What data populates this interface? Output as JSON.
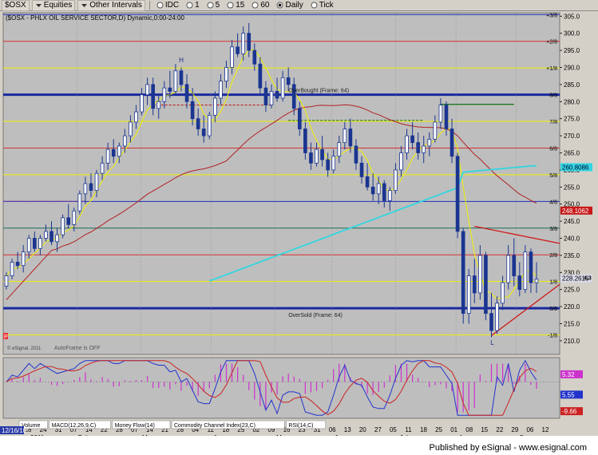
{
  "toolbar": {
    "symbol": "$OSX",
    "equities": "Equities",
    "other_intervals": "Other Intervals",
    "intervals": [
      "IDC",
      "1",
      "5",
      "15",
      "60",
      "Daily",
      "Tick"
    ],
    "active_interval": "Daily"
  },
  "chart_title": "($OSX - PHLX OIL SERVICE SECTOR,D) Dynamic,0:00-24:00",
  "watermark": "© eSignal, 2011",
  "autoframe_note": "AutoFrame is OFF",
  "left_tag": "P",
  "date_badge": "12/16/10",
  "year_label": "2011",
  "credit": "Published by eSignal - www.esignal.com",
  "panes_tabs": [
    "Volume",
    "MACD(12,26,9,C)",
    "Money Flow(14)",
    "Commodity Channel Index(23,C)",
    "RSI(14,C)"
  ],
  "colors": {
    "chart_bg": "#bebebe",
    "candle": "#1a3590",
    "ma_red": "#b22222",
    "ma_yellow": "#f0f000",
    "ma_cyan": "#33d6e0",
    "red_line": "#d63030",
    "yellow_line": "#f0f000",
    "blue_line": "#1f2fb8",
    "thick_blue": "#1a2aa0",
    "green_line": "#1d7a1d"
  },
  "chart_data": {
    "type": "candlestick",
    "symbol": "$OSX",
    "name": "PHLX OIL SERVICE SECTOR",
    "interval": "Daily",
    "y_range": [
      206,
      306
    ],
    "y_ticks": [
      210,
      215,
      220,
      225,
      230,
      235,
      240,
      245,
      250,
      255,
      260,
      265,
      270,
      275,
      280,
      285,
      290,
      295,
      300,
      305
    ],
    "x_ticks": [
      "10",
      "18",
      "24",
      "31",
      "07",
      "14",
      "22",
      "28",
      "07",
      "14",
      "21",
      "28",
      "04",
      "11",
      "18",
      "25",
      "02",
      "09",
      "16",
      "23",
      "31",
      "06",
      "13",
      "20",
      "27",
      "05",
      "11",
      "18",
      "25",
      "01",
      "08",
      "15",
      "22",
      "29",
      "06",
      "12"
    ],
    "month_labels": [
      "Feb",
      "Mar",
      "Apr",
      "May",
      "Jun",
      "Jul",
      "Aug",
      "Sep"
    ],
    "murrey_levels": [
      {
        "label": "+3/8",
        "value": 305.47
      },
      {
        "label": "+2/8",
        "value": 297.66
      },
      {
        "label": "+1/8",
        "value": 289.84
      },
      {
        "label": "8/8",
        "value": 282.03
      },
      {
        "label": "7/8",
        "value": 274.22
      },
      {
        "label": "6/8",
        "value": 266.41
      },
      {
        "label": "5/8",
        "value": 258.59
      },
      {
        "label": "4/8",
        "value": 250.78
      },
      {
        "label": "3/8",
        "value": 242.97
      },
      {
        "label": "2/8",
        "value": 235.16
      },
      {
        "label": "1/8",
        "value": 227.34
      },
      {
        "label": "0/8",
        "value": 219.53
      },
      {
        "label": "-1/8",
        "value": 211.72
      }
    ],
    "frame_labels": {
      "overbought": "OverBought (Frame: 64)",
      "oversold": "OverSold (Frame: 64)"
    },
    "price_labels": {
      "ma_cyan": "260.8086",
      "ma_red": "248.1062",
      "last": "228.2616",
      "last_suffix": "4.3"
    },
    "indicator_values": [
      "5.32",
      "5.55",
      "-9.66"
    ],
    "annotations": [
      "H",
      "L"
    ],
    "candles": [
      {
        "t": 0,
        "o": 226,
        "h": 230,
        "l": 225,
        "c": 229
      },
      {
        "t": 1,
        "o": 229,
        "h": 234,
        "l": 228,
        "c": 233
      },
      {
        "t": 2,
        "o": 233,
        "h": 236,
        "l": 231,
        "c": 232
      },
      {
        "t": 3,
        "o": 232,
        "h": 238,
        "l": 230,
        "c": 236
      },
      {
        "t": 4,
        "o": 236,
        "h": 241,
        "l": 234,
        "c": 240
      },
      {
        "t": 5,
        "o": 240,
        "h": 242,
        "l": 236,
        "c": 237
      },
      {
        "t": 6,
        "o": 237,
        "h": 241,
        "l": 235,
        "c": 240
      },
      {
        "t": 7,
        "o": 240,
        "h": 244,
        "l": 239,
        "c": 242
      },
      {
        "t": 8,
        "o": 242,
        "h": 245,
        "l": 238,
        "c": 239
      },
      {
        "t": 9,
        "o": 239,
        "h": 243,
        "l": 236,
        "c": 241
      },
      {
        "t": 10,
        "o": 241,
        "h": 247,
        "l": 240,
        "c": 246
      },
      {
        "t": 11,
        "o": 246,
        "h": 250,
        "l": 243,
        "c": 244
      },
      {
        "t": 12,
        "o": 244,
        "h": 249,
        "l": 242,
        "c": 248
      },
      {
        "t": 13,
        "o": 248,
        "h": 254,
        "l": 247,
        "c": 253
      },
      {
        "t": 14,
        "o": 253,
        "h": 258,
        "l": 250,
        "c": 256
      },
      {
        "t": 15,
        "o": 256,
        "h": 259,
        "l": 252,
        "c": 254
      },
      {
        "t": 16,
        "o": 254,
        "h": 260,
        "l": 252,
        "c": 259
      },
      {
        "t": 17,
        "o": 259,
        "h": 264,
        "l": 257,
        "c": 262
      },
      {
        "t": 18,
        "o": 262,
        "h": 268,
        "l": 260,
        "c": 266
      },
      {
        "t": 19,
        "o": 266,
        "h": 269,
        "l": 262,
        "c": 264
      },
      {
        "t": 20,
        "o": 264,
        "h": 268,
        "l": 262,
        "c": 267
      },
      {
        "t": 21,
        "o": 267,
        "h": 272,
        "l": 265,
        "c": 270
      },
      {
        "t": 22,
        "o": 270,
        "h": 276,
        "l": 268,
        "c": 274
      },
      {
        "t": 23,
        "o": 274,
        "h": 279,
        "l": 272,
        "c": 277
      },
      {
        "t": 24,
        "o": 277,
        "h": 284,
        "l": 276,
        "c": 282
      },
      {
        "t": 25,
        "o": 282,
        "h": 287,
        "l": 279,
        "c": 285
      },
      {
        "t": 26,
        "o": 285,
        "h": 287,
        "l": 276,
        "c": 278
      },
      {
        "t": 27,
        "o": 278,
        "h": 282,
        "l": 275,
        "c": 280
      },
      {
        "t": 28,
        "o": 280,
        "h": 286,
        "l": 278,
        "c": 284
      },
      {
        "t": 29,
        "o": 284,
        "h": 289,
        "l": 281,
        "c": 283
      },
      {
        "t": 30,
        "o": 283,
        "h": 291,
        "l": 282,
        "c": 289
      },
      {
        "t": 31,
        "o": 289,
        "h": 290,
        "l": 283,
        "c": 285
      },
      {
        "t": 32,
        "o": 285,
        "h": 288,
        "l": 278,
        "c": 280
      },
      {
        "t": 33,
        "o": 280,
        "h": 284,
        "l": 273,
        "c": 275
      },
      {
        "t": 34,
        "o": 275,
        "h": 278,
        "l": 270,
        "c": 272
      },
      {
        "t": 35,
        "o": 272,
        "h": 276,
        "l": 268,
        "c": 270
      },
      {
        "t": 36,
        "o": 270,
        "h": 277,
        "l": 269,
        "c": 276
      },
      {
        "t": 37,
        "o": 276,
        "h": 283,
        "l": 274,
        "c": 281
      },
      {
        "t": 38,
        "o": 281,
        "h": 288,
        "l": 279,
        "c": 286
      },
      {
        "t": 39,
        "o": 286,
        "h": 292,
        "l": 284,
        "c": 290
      },
      {
        "t": 40,
        "o": 290,
        "h": 298,
        "l": 288,
        "c": 296
      },
      {
        "t": 41,
        "o": 296,
        "h": 300,
        "l": 293,
        "c": 294
      },
      {
        "t": 42,
        "o": 294,
        "h": 302,
        "l": 292,
        "c": 300
      },
      {
        "t": 43,
        "o": 300,
        "h": 303,
        "l": 293,
        "c": 295
      },
      {
        "t": 44,
        "o": 295,
        "h": 297,
        "l": 289,
        "c": 291
      },
      {
        "t": 45,
        "o": 291,
        "h": 293,
        "l": 282,
        "c": 284
      },
      {
        "t": 46,
        "o": 284,
        "h": 286,
        "l": 277,
        "c": 279
      },
      {
        "t": 47,
        "o": 279,
        "h": 285,
        "l": 278,
        "c": 283
      },
      {
        "t": 48,
        "o": 283,
        "h": 287,
        "l": 280,
        "c": 281
      },
      {
        "t": 49,
        "o": 281,
        "h": 289,
        "l": 280,
        "c": 287
      },
      {
        "t": 50,
        "o": 287,
        "h": 290,
        "l": 283,
        "c": 285
      },
      {
        "t": 51,
        "o": 285,
        "h": 287,
        "l": 276,
        "c": 278
      },
      {
        "t": 52,
        "o": 278,
        "h": 280,
        "l": 270,
        "c": 272
      },
      {
        "t": 53,
        "o": 272,
        "h": 274,
        "l": 263,
        "c": 265
      },
      {
        "t": 54,
        "o": 265,
        "h": 268,
        "l": 260,
        "c": 262
      },
      {
        "t": 55,
        "o": 262,
        "h": 268,
        "l": 261,
        "c": 266
      },
      {
        "t": 56,
        "o": 266,
        "h": 270,
        "l": 261,
        "c": 263
      },
      {
        "t": 57,
        "o": 263,
        "h": 265,
        "l": 258,
        "c": 260
      },
      {
        "t": 58,
        "o": 260,
        "h": 266,
        "l": 259,
        "c": 264
      },
      {
        "t": 59,
        "o": 264,
        "h": 270,
        "l": 262,
        "c": 268
      },
      {
        "t": 60,
        "o": 268,
        "h": 274,
        "l": 266,
        "c": 272
      },
      {
        "t": 61,
        "o": 272,
        "h": 275,
        "l": 265,
        "c": 267
      },
      {
        "t": 62,
        "o": 267,
        "h": 269,
        "l": 260,
        "c": 262
      },
      {
        "t": 63,
        "o": 262,
        "h": 264,
        "l": 256,
        "c": 258
      },
      {
        "t": 64,
        "o": 258,
        "h": 262,
        "l": 254,
        "c": 255
      },
      {
        "t": 65,
        "o": 255,
        "h": 259,
        "l": 251,
        "c": 253
      },
      {
        "t": 66,
        "o": 253,
        "h": 258,
        "l": 250,
        "c": 256
      },
      {
        "t": 67,
        "o": 256,
        "h": 257,
        "l": 249,
        "c": 251
      },
      {
        "t": 68,
        "o": 251,
        "h": 255,
        "l": 248,
        "c": 254
      },
      {
        "t": 69,
        "o": 254,
        "h": 262,
        "l": 253,
        "c": 260
      },
      {
        "t": 70,
        "o": 260,
        "h": 267,
        "l": 258,
        "c": 265
      },
      {
        "t": 71,
        "o": 265,
        "h": 272,
        "l": 263,
        "c": 270
      },
      {
        "t": 72,
        "o": 270,
        "h": 274,
        "l": 266,
        "c": 268
      },
      {
        "t": 73,
        "o": 268,
        "h": 271,
        "l": 263,
        "c": 265
      },
      {
        "t": 74,
        "o": 265,
        "h": 270,
        "l": 262,
        "c": 267
      },
      {
        "t": 75,
        "o": 267,
        "h": 271,
        "l": 264,
        "c": 269
      },
      {
        "t": 76,
        "o": 269,
        "h": 276,
        "l": 268,
        "c": 274
      },
      {
        "t": 77,
        "o": 274,
        "h": 281,
        "l": 272,
        "c": 279
      },
      {
        "t": 78,
        "o": 279,
        "h": 280,
        "l": 270,
        "c": 272
      },
      {
        "t": 79,
        "o": 272,
        "h": 275,
        "l": 262,
        "c": 264
      },
      {
        "t": 80,
        "o": 264,
        "h": 265,
        "l": 240,
        "c": 242
      },
      {
        "t": 81,
        "o": 242,
        "h": 243,
        "l": 215,
        "c": 218
      },
      {
        "t": 82,
        "o": 218,
        "h": 231,
        "l": 215,
        "c": 229
      },
      {
        "t": 83,
        "o": 229,
        "h": 234,
        "l": 221,
        "c": 224
      },
      {
        "t": 84,
        "o": 224,
        "h": 238,
        "l": 222,
        "c": 235
      },
      {
        "t": 85,
        "o": 235,
        "h": 236,
        "l": 216,
        "c": 218
      },
      {
        "t": 86,
        "o": 218,
        "h": 224,
        "l": 211,
        "c": 213
      },
      {
        "t": 87,
        "o": 213,
        "h": 223,
        "l": 212,
        "c": 221
      },
      {
        "t": 88,
        "o": 221,
        "h": 229,
        "l": 219,
        "c": 227
      },
      {
        "t": 89,
        "o": 227,
        "h": 238,
        "l": 225,
        "c": 235
      },
      {
        "t": 90,
        "o": 235,
        "h": 240,
        "l": 226,
        "c": 229
      },
      {
        "t": 91,
        "o": 229,
        "h": 233,
        "l": 223,
        "c": 225
      },
      {
        "t": 92,
        "o": 225,
        "h": 238,
        "l": 224,
        "c": 236
      },
      {
        "t": 93,
        "o": 236,
        "h": 237,
        "l": 224,
        "c": 227
      },
      {
        "t": 94,
        "o": 227,
        "h": 233,
        "l": 224,
        "c": 228
      }
    ],
    "lower_pane": {
      "name": "MACD(12,26,9,C)",
      "y_range": [
        -12,
        8
      ]
    }
  }
}
